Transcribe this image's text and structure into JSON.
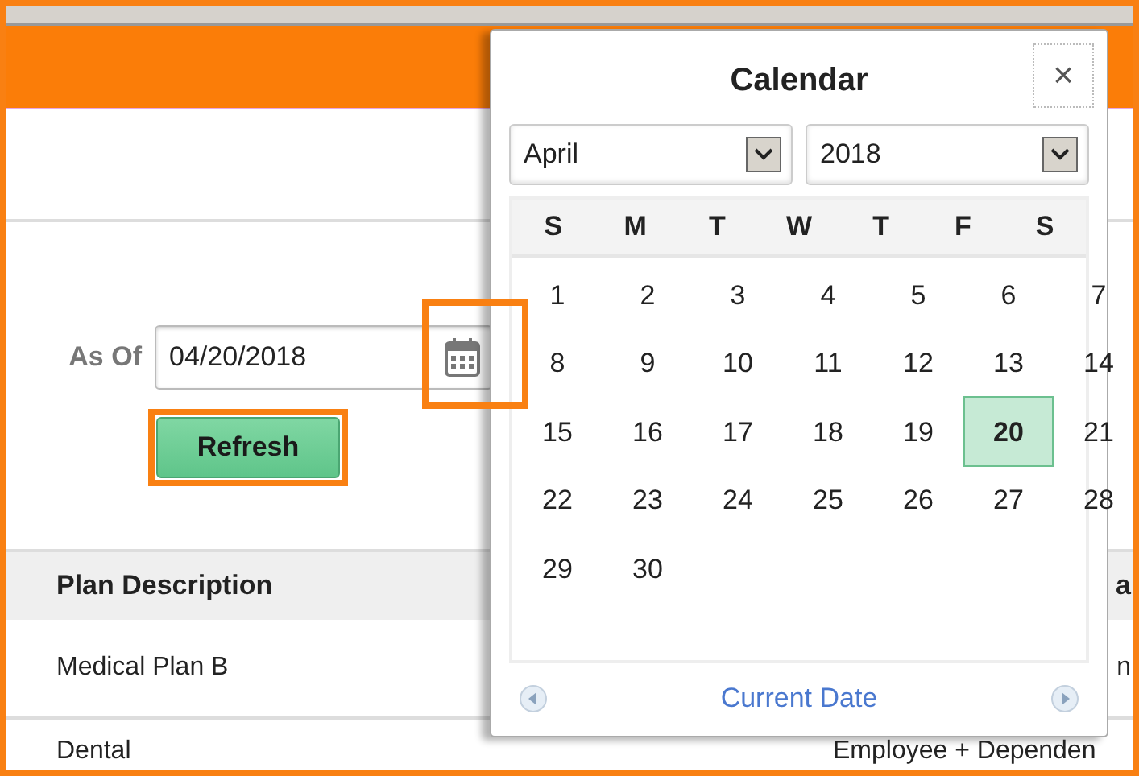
{
  "filter": {
    "label": "As Of",
    "date_value": "04/20/2018",
    "button": "Refresh"
  },
  "table": {
    "columns": [
      "Plan Description",
      "a"
    ],
    "rows": [
      [
        "Medical Plan B",
        "n"
      ],
      [
        "Dental",
        "Employee + Dependen"
      ]
    ]
  },
  "calendar": {
    "title": "Calendar",
    "close": "×",
    "month": "April",
    "year": "2018",
    "weekdays": [
      "S",
      "M",
      "T",
      "W",
      "T",
      "F",
      "S"
    ],
    "days": [
      {
        "label": "1",
        "selected": false
      },
      {
        "label": "2",
        "selected": false
      },
      {
        "label": "3",
        "selected": false
      },
      {
        "label": "4",
        "selected": false
      },
      {
        "label": "5",
        "selected": false
      },
      {
        "label": "6",
        "selected": false
      },
      {
        "label": "7",
        "selected": false
      },
      {
        "label": "8",
        "selected": false
      },
      {
        "label": "9",
        "selected": false
      },
      {
        "label": "10",
        "selected": false
      },
      {
        "label": "11",
        "selected": false
      },
      {
        "label": "12",
        "selected": false
      },
      {
        "label": "13",
        "selected": false
      },
      {
        "label": "14",
        "selected": false
      },
      {
        "label": "15",
        "selected": false
      },
      {
        "label": "16",
        "selected": false
      },
      {
        "label": "17",
        "selected": false
      },
      {
        "label": "18",
        "selected": false
      },
      {
        "label": "19",
        "selected": false
      },
      {
        "label": "20",
        "selected": true
      },
      {
        "label": "21",
        "selected": false
      },
      {
        "label": "22",
        "selected": false
      },
      {
        "label": "23",
        "selected": false
      },
      {
        "label": "24",
        "selected": false
      },
      {
        "label": "25",
        "selected": false
      },
      {
        "label": "26",
        "selected": false
      },
      {
        "label": "27",
        "selected": false
      },
      {
        "label": "28",
        "selected": false
      },
      {
        "label": "29",
        "selected": false
      },
      {
        "label": "30",
        "selected": false
      }
    ],
    "footer_link": "Current Date"
  }
}
